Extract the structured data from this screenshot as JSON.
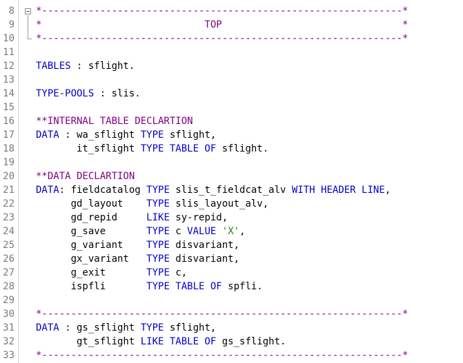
{
  "editor": {
    "lines": [
      {
        "num": "8",
        "tokens": [
          {
            "t": "*--------------------------------------------------------------*",
            "c": "cm"
          }
        ]
      },
      {
        "num": "9",
        "tokens": [
          {
            "t": "*                            TOP                               *",
            "c": "cm"
          }
        ]
      },
      {
        "num": "10",
        "tokens": [
          {
            "t": "*--------------------------------------------------------------*",
            "c": "cm"
          }
        ]
      },
      {
        "num": "11",
        "tokens": []
      },
      {
        "num": "12",
        "tokens": [
          {
            "t": "TABLES",
            "c": "kw"
          },
          {
            "t": " : sflight.",
            "c": ""
          }
        ]
      },
      {
        "num": "13",
        "tokens": []
      },
      {
        "num": "14",
        "tokens": [
          {
            "t": "TYPE-POOLS",
            "c": "kw"
          },
          {
            "t": " : slis.",
            "c": ""
          }
        ]
      },
      {
        "num": "15",
        "tokens": []
      },
      {
        "num": "16",
        "tokens": [
          {
            "t": "**INTERNAL TABLE DECLARTION",
            "c": "cm"
          }
        ]
      },
      {
        "num": "17",
        "tokens": [
          {
            "t": "DATA",
            "c": "kw"
          },
          {
            "t": " : wa_sflight ",
            "c": ""
          },
          {
            "t": "TYPE",
            "c": "kw"
          },
          {
            "t": " sflight,",
            "c": ""
          }
        ]
      },
      {
        "num": "18",
        "tokens": [
          {
            "t": "       it_sflight ",
            "c": ""
          },
          {
            "t": "TYPE TABLE OF",
            "c": "kw"
          },
          {
            "t": " sflight.",
            "c": ""
          }
        ]
      },
      {
        "num": "19",
        "tokens": []
      },
      {
        "num": "20",
        "tokens": [
          {
            "t": "**DATA DECLARTION",
            "c": "cm"
          }
        ]
      },
      {
        "num": "21",
        "tokens": [
          {
            "t": "DATA",
            "c": "kw"
          },
          {
            "t": ": fieldcatalog ",
            "c": ""
          },
          {
            "t": "TYPE",
            "c": "kw"
          },
          {
            "t": " slis_t_fieldcat_alv ",
            "c": ""
          },
          {
            "t": "WITH HEADER LINE",
            "c": "kw"
          },
          {
            "t": ",",
            "c": ""
          }
        ]
      },
      {
        "num": "22",
        "tokens": [
          {
            "t": "      gd_layout    ",
            "c": ""
          },
          {
            "t": "TYPE",
            "c": "kw"
          },
          {
            "t": " slis_layout_alv,",
            "c": ""
          }
        ]
      },
      {
        "num": "23",
        "tokens": [
          {
            "t": "      gd_repid     ",
            "c": ""
          },
          {
            "t": "LIKE",
            "c": "kw"
          },
          {
            "t": " sy-repid,",
            "c": ""
          }
        ]
      },
      {
        "num": "24",
        "tokens": [
          {
            "t": "      g_save       ",
            "c": ""
          },
          {
            "t": "TYPE",
            "c": "kw"
          },
          {
            "t": " c ",
            "c": ""
          },
          {
            "t": "VALUE",
            "c": "kw"
          },
          {
            "t": " ",
            "c": ""
          },
          {
            "t": "'X'",
            "c": "str"
          },
          {
            "t": ",",
            "c": ""
          }
        ]
      },
      {
        "num": "25",
        "tokens": [
          {
            "t": "      g_variant    ",
            "c": ""
          },
          {
            "t": "TYPE",
            "c": "kw"
          },
          {
            "t": " disvariant,",
            "c": ""
          }
        ]
      },
      {
        "num": "26",
        "tokens": [
          {
            "t": "      gx_variant   ",
            "c": ""
          },
          {
            "t": "TYPE",
            "c": "kw"
          },
          {
            "t": " disvariant,",
            "c": ""
          }
        ]
      },
      {
        "num": "27",
        "tokens": [
          {
            "t": "      g_exit       ",
            "c": ""
          },
          {
            "t": "TYPE",
            "c": "kw"
          },
          {
            "t": " c,",
            "c": ""
          }
        ]
      },
      {
        "num": "28",
        "tokens": [
          {
            "t": "      ispfli       ",
            "c": ""
          },
          {
            "t": "TYPE TABLE OF",
            "c": "kw"
          },
          {
            "t": " spfli.",
            "c": ""
          }
        ]
      },
      {
        "num": "29",
        "tokens": []
      },
      {
        "num": "30",
        "tokens": [
          {
            "t": "*--------------------------------------------------------------*",
            "c": "cm"
          }
        ]
      },
      {
        "num": "31",
        "tokens": [
          {
            "t": "DATA",
            "c": "kw"
          },
          {
            "t": " : gs_sflight ",
            "c": ""
          },
          {
            "t": "TYPE",
            "c": "kw"
          },
          {
            "t": " sflight,",
            "c": ""
          }
        ]
      },
      {
        "num": "32",
        "tokens": [
          {
            "t": "       gt_sflight ",
            "c": ""
          },
          {
            "t": "LIKE TABLE OF",
            "c": "kw"
          },
          {
            "t": " gs_sflight.",
            "c": ""
          }
        ]
      },
      {
        "num": "33",
        "tokens": [
          {
            "t": "*--------------------------------------------------------------*",
            "c": "cm"
          }
        ]
      }
    ]
  },
  "colors": {
    "keyword": "#0000c8",
    "comment": "#800080",
    "string": "#208020",
    "line_number": "#7a7a7a"
  },
  "icons": {
    "fold": "fold-collapse-icon"
  }
}
